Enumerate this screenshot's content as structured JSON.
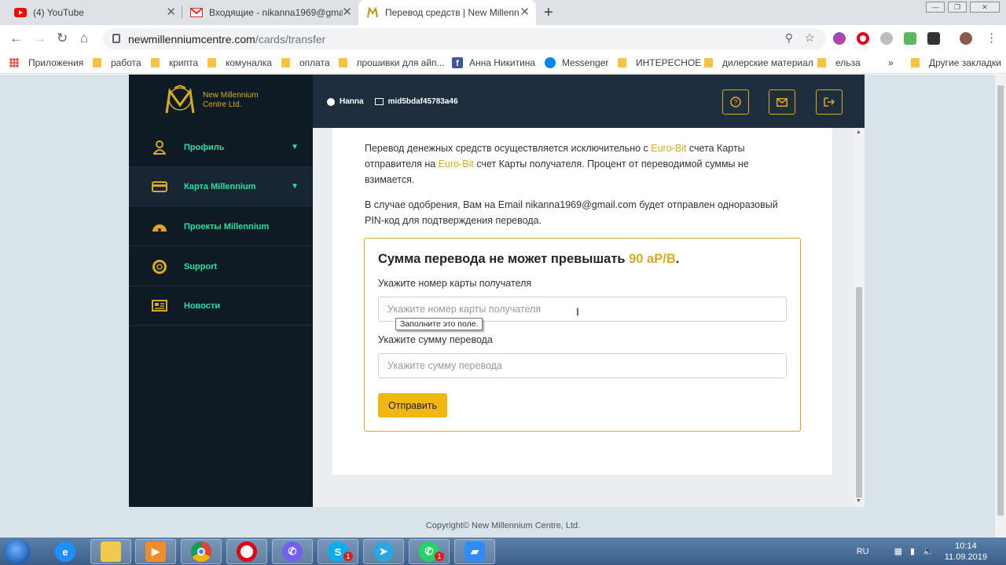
{
  "browser": {
    "tabs": [
      {
        "title": "(4) YouTube",
        "icon": "youtube-icon",
        "active": false
      },
      {
        "title": "Входящие - nikanna1969@gmail",
        "icon": "gmail-icon",
        "active": false
      },
      {
        "title": "Перевод средств | New Millenniu",
        "icon": "millennium-favicon",
        "active": true
      }
    ],
    "url_host": "newmillenniumcentre.com",
    "url_path": "/cards/transfer",
    "bookmarks": [
      {
        "label": "Приложения",
        "icon": "apps-icon"
      },
      {
        "label": "работа",
        "icon": "folder-icon"
      },
      {
        "label": "крипта",
        "icon": "folder-icon"
      },
      {
        "label": "комуналка",
        "icon": "folder-icon"
      },
      {
        "label": "оплата",
        "icon": "folder-icon"
      },
      {
        "label": "прошивки для айп...",
        "icon": "folder-icon"
      },
      {
        "label": "Анна Никитина",
        "icon": "facebook-icon"
      },
      {
        "label": "Messenger",
        "icon": "messenger-icon"
      },
      {
        "label": "ИНТЕРЕСНОЕ",
        "icon": "folder-icon"
      },
      {
        "label": "дилерские материал",
        "icon": "folder-icon"
      },
      {
        "label": "ельза",
        "icon": "folder-icon"
      },
      {
        "label": "Другие закладки",
        "icon": "folder-icon"
      }
    ],
    "more_bookmarks": "»"
  },
  "site": {
    "logo_line1": "New Millennium",
    "logo_line2": "Centre Ltd.",
    "nav": [
      {
        "label": "Профиль",
        "icon": "user-icon",
        "has_chevron": true
      },
      {
        "label": "Карта Millennium",
        "icon": "card-icon",
        "has_chevron": true
      },
      {
        "label": "Проекты Millennium",
        "icon": "dashboard-icon",
        "has_chevron": false
      },
      {
        "label": "Support",
        "icon": "lifebuoy-icon",
        "has_chevron": false
      },
      {
        "label": "Новости",
        "icon": "news-icon",
        "has_chevron": false
      }
    ],
    "user_name": "Hanna",
    "user_id": "mid5bdaf45783a46",
    "accent": "#d8ac22",
    "nav_text_color": "#29e0a4"
  },
  "transfer": {
    "intro1_a": "Перевод денежных средств осуществляется исключительно с ",
    "intro1_hl1": "Euro-Bit",
    "intro1_b": " счета Карты отправителя на ",
    "intro1_hl2": "Euro-Bit",
    "intro1_c": " счет Карты получателя. Процент от переводимой суммы не взимается.",
    "intro2": "В случае одобрения, Вам на Email nikanna1969@gmail.com будет отправлен одноразовый PIN-код для подтверждения перевода.",
    "title_a": "Сумма перевода не может превышать ",
    "title_limit": "90 aP/B",
    "title_b": ".",
    "card_label": "Укажите номер карты получателя",
    "card_placeholder": "Укажите номер карты получателя",
    "tooltip": "Заполните это поле.",
    "amount_label": "Укажите сумму перевода",
    "amount_placeholder": "Укажите сумму перевода",
    "submit": "Отправить"
  },
  "footer": "Copyright© New Millennium Centre, Ltd.",
  "taskbar": {
    "lang": "RU",
    "time": "10:14",
    "date": "11.09.2019",
    "apps": [
      {
        "name": "internet-explorer-icon"
      },
      {
        "name": "file-explorer-icon"
      },
      {
        "name": "media-player-icon"
      },
      {
        "name": "chrome-icon"
      },
      {
        "name": "opera-icon"
      },
      {
        "name": "viber-icon"
      },
      {
        "name": "skype-icon",
        "badge": "1"
      },
      {
        "name": "telegram-icon"
      },
      {
        "name": "whatsapp-icon",
        "badge": "1"
      },
      {
        "name": "zoom-icon"
      }
    ]
  }
}
